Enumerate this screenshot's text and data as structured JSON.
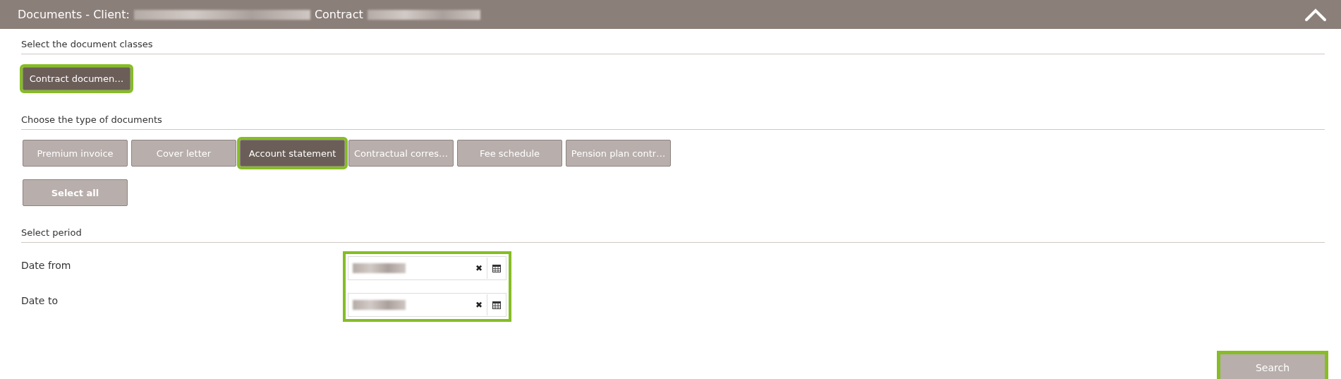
{
  "header": {
    "title": "Documents - Client:",
    "contract_label": "Contract",
    "expanded": true
  },
  "classes": {
    "heading": "Select the document classes",
    "buttons": [
      {
        "label": "Contract documen…",
        "selected": true,
        "highlighted": true
      }
    ]
  },
  "types": {
    "heading": "Choose the type of documents",
    "buttons": [
      {
        "label": "Premium invoice",
        "selected": false,
        "highlighted": false
      },
      {
        "label": "Cover letter",
        "selected": false,
        "highlighted": false
      },
      {
        "label": "Account statement",
        "selected": true,
        "highlighted": true
      },
      {
        "label": "Contractual corres…",
        "selected": false,
        "highlighted": false
      },
      {
        "label": "Fee schedule",
        "selected": false,
        "highlighted": false
      },
      {
        "label": "Pension plan contr…",
        "selected": false,
        "highlighted": false
      }
    ],
    "select_all": "Select all"
  },
  "period": {
    "heading": "Select period",
    "highlighted": true,
    "fields": [
      {
        "label": "Date from",
        "clear": "✖"
      },
      {
        "label": "Date to",
        "clear": "✖"
      }
    ]
  },
  "search": {
    "label": "Search",
    "highlighted": true
  }
}
